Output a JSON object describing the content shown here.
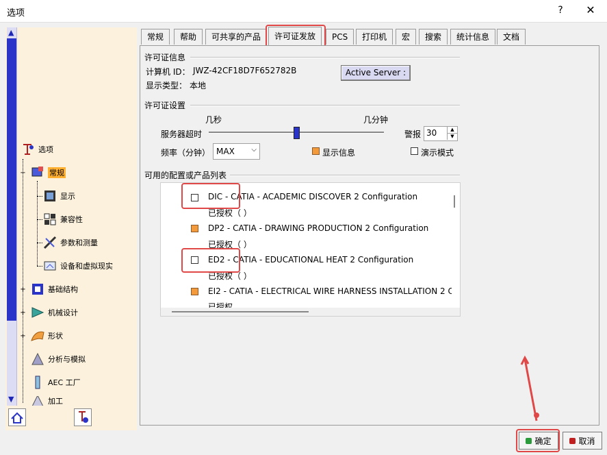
{
  "window": {
    "title": "选项",
    "help": "?",
    "close": "✕"
  },
  "tree": {
    "root": "选项",
    "items": [
      {
        "label": "常规",
        "selected": true
      },
      {
        "label": "显示"
      },
      {
        "label": "兼容性"
      },
      {
        "label": "参数和测量"
      },
      {
        "label": "设备和虚拟现实"
      },
      {
        "label": "基础结构"
      },
      {
        "label": "机械设计"
      },
      {
        "label": "形状"
      },
      {
        "label": "分析与模拟"
      },
      {
        "label": "AEC 工厂"
      },
      {
        "label": "加工"
      }
    ]
  },
  "tabs": [
    "常规",
    "帮助",
    "可共享的产品",
    "许可证发放",
    "PCS",
    "打印机",
    "宏",
    "搜索",
    "统计信息",
    "文档"
  ],
  "active_tab": "许可证发放",
  "license_info": {
    "section_title": "许可证信息",
    "computer_id_label": "计算机 ID：",
    "computer_id": "JWZ-42CF18D7F652782B",
    "display_type_label": "显示类型：",
    "display_type": "本地",
    "active_server_button": "Active Server :"
  },
  "license_settings": {
    "section_title": "许可证设置",
    "seconds_label": "几秒",
    "minutes_label": "几分钟",
    "server_timeout_label": "服务器超时",
    "alarm_label": "警报",
    "alarm_value": "30",
    "frequency_label": "频率（分钟）",
    "frequency_value": "MAX",
    "show_info_label": "显示信息",
    "show_info_checked": true,
    "demo_mode_label": "演示模式",
    "demo_mode_checked": false
  },
  "product_list": {
    "section_title": "可用的配置或产品列表",
    "items": [
      {
        "label": "DIC - CATIA - ACADEMIC DISCOVER 2 Configuration",
        "sub": "已授权（ ）",
        "checked": false
      },
      {
        "label": "DP2 - CATIA - DRAWING PRODUCTION 2 Configuration",
        "sub": "已授权（ ）",
        "checked": true
      },
      {
        "label": "ED2 - CATIA - EDUCATIONAL HEAT 2 Configuration",
        "sub": "已授权（ ）",
        "checked": false
      },
      {
        "label": "EI2 - CATIA - ELECTRICAL WIRE HARNESS INSTALLATION 2 C",
        "sub": "已授权",
        "checked": true
      }
    ]
  },
  "footer": {
    "ok": "确定",
    "cancel": "取消"
  },
  "colors": {
    "accent_blue": "#2a34c8",
    "highlight": "#e04848",
    "selected": "#ffb030",
    "checkbox_on": "#f29a3c"
  }
}
